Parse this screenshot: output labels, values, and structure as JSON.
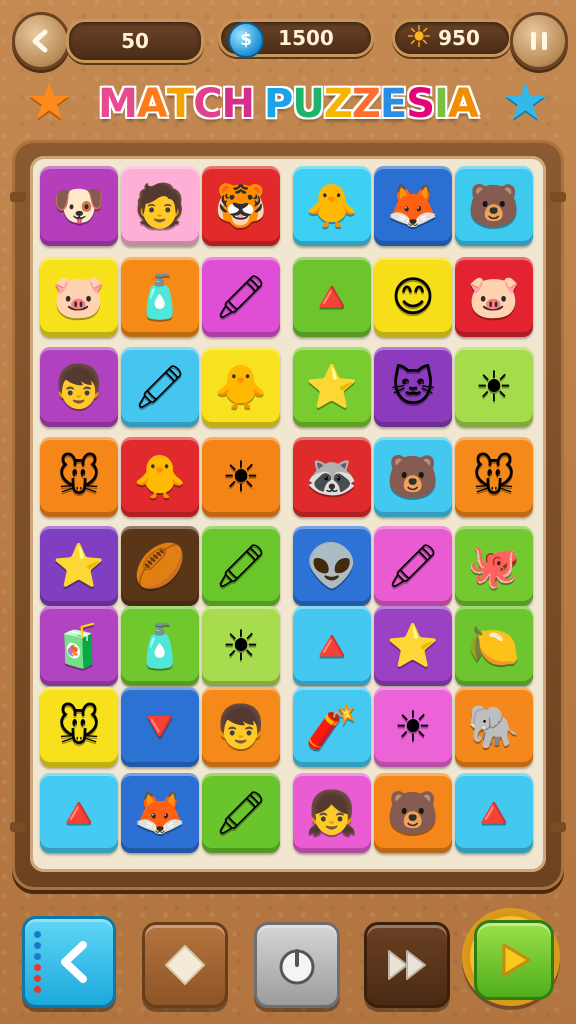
{
  "header": {
    "back_icon": "back-arrow-icon",
    "moves": "50",
    "coins": "1500",
    "coin_icon": "dollar-coin-icon",
    "coin_symbol": "$",
    "sun_points": "950",
    "sun_icon": "sun-icon",
    "pause_icon": "pause-icon"
  },
  "title": {
    "letters": [
      "M",
      "A",
      "T",
      "C",
      "H",
      " ",
      "P",
      "U",
      "Z",
      "Z",
      "E",
      "S",
      "I",
      "A"
    ],
    "colors": [
      "#e84a8f",
      "#ff7a1a",
      "#f5a300",
      "#e2408c",
      "#d62f8a",
      "#ffffff",
      "#1aa3e6",
      "#1fb36a",
      "#f5b400",
      "#ff6d2e",
      "#2b8ee0",
      "#e6007a",
      "#7bc043",
      "#f28c00"
    ]
  },
  "decor": {
    "left_star_color": "#ff8a1c",
    "right_star_color": "#35b8e8"
  },
  "board": {
    "rows": [
      [
        {
          "bg": "#b53fbb",
          "glyph": "🐶",
          "icon": "dog-hat-icon"
        },
        {
          "bg": "#ffaed6",
          "glyph": "🧑",
          "icon": "boy-cap-icon"
        },
        {
          "bg": "#e22a2a",
          "glyph": "🐯",
          "icon": "tiger-icon"
        },
        {
          "bg": "#3ed0f2",
          "glyph": "🐥",
          "icon": "chick-icon"
        },
        {
          "bg": "#2a6fd1",
          "glyph": "🦊",
          "icon": "fox-icon"
        },
        {
          "bg": "#3ec9ef",
          "glyph": "🐻",
          "icon": "polar-bear-icon"
        }
      ],
      [
        {
          "bg": "#f7e11b",
          "glyph": "🐷",
          "icon": "pig-icon"
        },
        {
          "bg": "#f58a17",
          "glyph": "🧴",
          "icon": "bottle-icon"
        },
        {
          "bg": "#df4fd6",
          "glyph": "🖍",
          "icon": "crayon-icon"
        },
        {
          "bg": "#6cc52d",
          "glyph": "🔺",
          "icon": "paper-plane-icon"
        },
        {
          "bg": "#f6df19",
          "glyph": "😊",
          "icon": "blue-face-icon"
        },
        {
          "bg": "#e3232f",
          "glyph": "🐷",
          "icon": "pig-icon"
        }
      ],
      [
        {
          "bg": "#b142bf",
          "glyph": "👦",
          "icon": "boy-icon"
        },
        {
          "bg": "#45c6f0",
          "glyph": "🖍",
          "icon": "striped-crayon-icon"
        },
        {
          "bg": "#f8e11e",
          "glyph": "🐥",
          "icon": "chick-icon"
        },
        {
          "bg": "#79cc2f",
          "glyph": "⭐",
          "icon": "orange-star-icon"
        },
        {
          "bg": "#8c3bbd",
          "glyph": "🐱",
          "icon": "blue-cat-icon"
        },
        {
          "bg": "#a4dc4c",
          "glyph": "☀",
          "icon": "sun-icon"
        }
      ],
      [
        {
          "bg": "#f5861a",
          "glyph": "🐭",
          "icon": "mouse-icon"
        },
        {
          "bg": "#e12a2e",
          "glyph": "🐥",
          "icon": "chick-icon"
        },
        {
          "bg": "#f58416",
          "glyph": "☀",
          "icon": "sun-icon"
        },
        {
          "bg": "#df2b2c",
          "glyph": "🦝",
          "icon": "raccoon-icon"
        },
        {
          "bg": "#43c9f0",
          "glyph": "🐻",
          "icon": "polar-bear-icon"
        },
        {
          "bg": "#f5891a",
          "glyph": "🐭",
          "icon": "mouse-icon"
        }
      ],
      [
        {
          "bg": "#7f3fc0",
          "glyph": "⭐",
          "icon": "star-icon"
        },
        {
          "bg": "#5a3618",
          "glyph": "🏉",
          "icon": "football-icon"
        },
        {
          "bg": "#6bc62c",
          "glyph": "🖍",
          "icon": "crayon-icon"
        },
        {
          "bg": "#2d72d4",
          "glyph": "👽",
          "icon": "green-alien-icon"
        },
        {
          "bg": "#e95bd1",
          "glyph": "🖍",
          "icon": "crayon-icon"
        },
        {
          "bg": "#74c931",
          "glyph": "🐙",
          "icon": "octopus-icon"
        }
      ],
      [
        {
          "bg": "#b144c0",
          "glyph": "🧃",
          "icon": "striped-bottle-icon"
        },
        {
          "bg": "#6fc82e",
          "glyph": "🧴",
          "icon": "bottle-icon"
        },
        {
          "bg": "#a7dc4e",
          "glyph": "☀",
          "icon": "sun-icon"
        },
        {
          "bg": "#44c8f0",
          "glyph": "🔺",
          "icon": "paper-plane-icon"
        },
        {
          "bg": "#9a41c4",
          "glyph": "⭐",
          "icon": "star-icon"
        },
        {
          "bg": "#6dc62f",
          "glyph": "🍋",
          "icon": "lemon-icon"
        }
      ],
      [
        {
          "bg": "#f7e01c",
          "glyph": "🐭",
          "icon": "mouse-icon"
        },
        {
          "bg": "#2c72d3",
          "glyph": "🔻",
          "icon": "traffic-cone-icon"
        },
        {
          "bg": "#f5891a",
          "glyph": "👦",
          "icon": "boy-hat-icon"
        },
        {
          "bg": "#45c9f1",
          "glyph": "🧨",
          "icon": "rocket-icon"
        },
        {
          "bg": "#ec63d7",
          "glyph": "☀",
          "icon": "sun-icon"
        },
        {
          "bg": "#f5881c",
          "glyph": "🐘",
          "icon": "elephant-icon"
        }
      ],
      [
        {
          "bg": "#47caf1",
          "glyph": "🔺",
          "icon": "paper-plane-icon"
        },
        {
          "bg": "#2b70d2",
          "glyph": "🦊",
          "icon": "fox-icon"
        },
        {
          "bg": "#6ac42b",
          "glyph": "🖍",
          "icon": "crayon-icon"
        },
        {
          "bg": "#e95cd2",
          "glyph": "👧",
          "icon": "girl-icon"
        },
        {
          "bg": "#f5861a",
          "glyph": "🐻",
          "icon": "bear-icon"
        },
        {
          "bg": "#43c8f0",
          "glyph": "🔺",
          "icon": "paper-plane-icon"
        }
      ]
    ]
  },
  "controls": {
    "undo_icon": "undo-arrow-icon",
    "hint_icon": "diamond-hint-icon",
    "power_icon": "power-icon",
    "fast_forward_icon": "fast-forward-icon",
    "play_icon": "play-icon"
  }
}
